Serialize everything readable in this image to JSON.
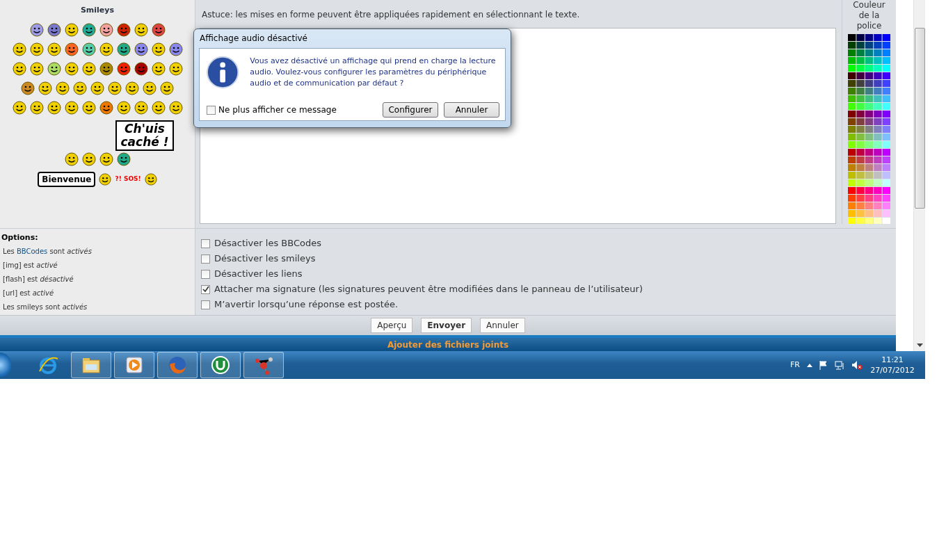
{
  "smileys": {
    "title": "Smileys",
    "signs": [
      {
        "kind": "board",
        "text": "Ch'uis caché !"
      },
      {
        "kind": "banner",
        "text": "Bienvenue"
      },
      {
        "kind": "alarm",
        "text": "?! SOS!"
      }
    ]
  },
  "tip": "Astuce: les mises en forme peuvent être appliquées rapidement en sélectionnant le texte.",
  "color_palette": {
    "title": "Couleur de la police"
  },
  "options": {
    "title": "Options:",
    "lines": [
      {
        "prefix": "Les ",
        "link": "BBCodes",
        "suffix": " sont *activés*"
      },
      {
        "prefix": "[img] est *activé*"
      },
      {
        "prefix": "[flash] est *désactivé*"
      },
      {
        "prefix": "[url] est *activé*"
      },
      {
        "prefix": "Les smileys sont *activés*"
      }
    ]
  },
  "checkboxes": [
    {
      "label": "Désactiver les BBCodes",
      "checked": false
    },
    {
      "label": "Désactiver les smileys",
      "checked": false
    },
    {
      "label": "Désactiver les liens",
      "checked": false
    },
    {
      "label": "Attacher ma signature (les signatures peuvent être modifiées dans le panneau de l’utilisateur)",
      "checked": true
    },
    {
      "label": "M’avertir lorsqu’une réponse est postée.",
      "checked": false
    }
  ],
  "buttons": [
    {
      "label": "Aperçu",
      "primary": false
    },
    {
      "label": "Envoyer",
      "primary": true
    },
    {
      "label": "Annuler",
      "primary": false
    }
  ],
  "attachments_bar": "Ajouter des fichiers joints",
  "dialog": {
    "title": "Affichage audio désactivé",
    "message": "Vous avez désactivé un affichage qui prend en charge la lecture audio. Voulez-vous configurer les paramètres du périphérique audio et de communication par défaut ?",
    "checkbox": {
      "label": "Ne plus afficher ce message",
      "checked": false
    },
    "buttons": [
      "Configurer",
      "Annuler"
    ]
  },
  "taskbar": {
    "apps": [
      {
        "kind": "ie",
        "running": false
      },
      {
        "kind": "explorer",
        "running": true
      },
      {
        "kind": "media",
        "running": true
      },
      {
        "kind": "firefox",
        "running": true
      },
      {
        "kind": "torrent",
        "running": true
      },
      {
        "kind": "molecule",
        "running": true
      }
    ],
    "language": "FR",
    "volume_muted": true,
    "time": "11:21",
    "date": "27/07/2012"
  }
}
